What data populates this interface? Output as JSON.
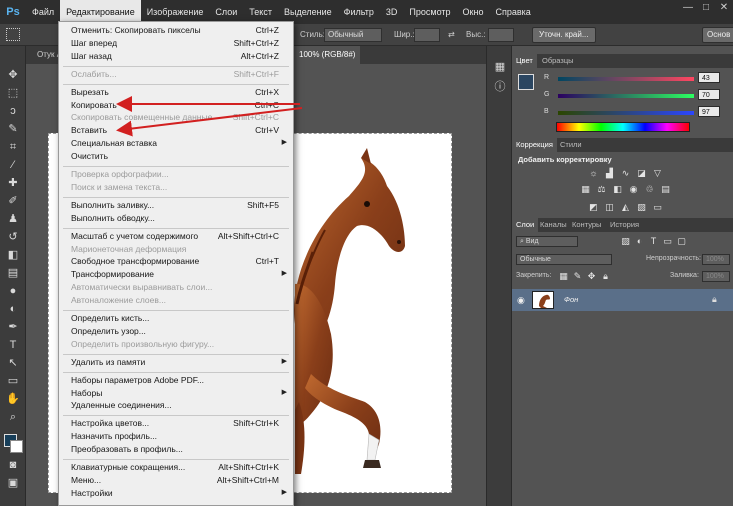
{
  "app": {
    "logo": "Ps"
  },
  "menubar": {
    "items": [
      "Файл",
      "Редактирование",
      "Изображение",
      "Слои",
      "Текст",
      "Выделение",
      "Фильтр",
      "3D",
      "Просмотр",
      "Окно",
      "Справка"
    ],
    "active_index": 1
  },
  "window_controls": {
    "minimize": "—",
    "maximize": "□",
    "close": "✕"
  },
  "options_bar": {
    "style_label": "Стиль:",
    "style_value": "Обычный",
    "width_label": "Шир.:",
    "height_label": "Выс.:",
    "refine_button": "Уточн. край...",
    "workspace_button": "Основ"
  },
  "document_tabs": [
    {
      "label": "Отук А"
    },
    {
      "label": "100% (RGB/8#)"
    }
  ],
  "dropdown": {
    "items": [
      {
        "label": "Отменить: Скопировать пикселы",
        "shortcut": "Ctrl+Z",
        "disabled": false
      },
      {
        "label": "Шаг вперед",
        "shortcut": "Shift+Ctrl+Z",
        "disabled": false
      },
      {
        "label": "Шаг назад",
        "shortcut": "Alt+Ctrl+Z",
        "disabled": false
      },
      {
        "sep": true
      },
      {
        "label": "Ослабить...",
        "shortcut": "Shift+Ctrl+F",
        "disabled": true
      },
      {
        "sep": true
      },
      {
        "label": "Вырезать",
        "shortcut": "Ctrl+X",
        "disabled": false
      },
      {
        "label": "Копировать",
        "shortcut": "Ctrl+C",
        "disabled": false
      },
      {
        "label": "Скопировать совмещенные данные",
        "shortcut": "Shift+Ctrl+C",
        "disabled": true
      },
      {
        "label": "Вставить",
        "shortcut": "Ctrl+V",
        "disabled": false
      },
      {
        "label": "Специальная вставка",
        "shortcut": "",
        "disabled": false,
        "submenu": true
      },
      {
        "label": "Очистить",
        "shortcut": "",
        "disabled": false
      },
      {
        "sep": true
      },
      {
        "label": "Проверка орфографии...",
        "shortcut": "",
        "disabled": true
      },
      {
        "label": "Поиск и замена текста...",
        "shortcut": "",
        "disabled": true
      },
      {
        "sep": true
      },
      {
        "label": "Выполнить заливку...",
        "shortcut": "Shift+F5",
        "disabled": false
      },
      {
        "label": "Выполнить обводку...",
        "shortcut": "",
        "disabled": false
      },
      {
        "sep": true
      },
      {
        "label": "Масштаб с учетом содержимого",
        "shortcut": "Alt+Shift+Ctrl+C",
        "disabled": false
      },
      {
        "label": "Марионеточная деформация",
        "shortcut": "",
        "disabled": true
      },
      {
        "label": "Свободное трансформирование",
        "shortcut": "Ctrl+T",
        "disabled": false
      },
      {
        "label": "Трансформирование",
        "shortcut": "",
        "disabled": false,
        "submenu": true
      },
      {
        "label": "Автоматически выравнивать слои...",
        "shortcut": "",
        "disabled": true
      },
      {
        "label": "Автоналожение слоев...",
        "shortcut": "",
        "disabled": true
      },
      {
        "sep": true
      },
      {
        "label": "Определить кисть...",
        "shortcut": "",
        "disabled": false
      },
      {
        "label": "Определить узор...",
        "shortcut": "",
        "disabled": false
      },
      {
        "label": "Определить произвольную фигуру...",
        "shortcut": "",
        "disabled": true
      },
      {
        "sep": true
      },
      {
        "label": "Удалить из памяти",
        "shortcut": "",
        "disabled": false,
        "submenu": true
      },
      {
        "sep": true
      },
      {
        "label": "Наборы параметров Adobe PDF...",
        "shortcut": "",
        "disabled": false
      },
      {
        "label": "Наборы",
        "shortcut": "",
        "disabled": false,
        "submenu": true
      },
      {
        "label": "Удаленные соединения...",
        "shortcut": "",
        "disabled": false
      },
      {
        "sep": true
      },
      {
        "label": "Настройка цветов...",
        "shortcut": "Shift+Ctrl+K",
        "disabled": false
      },
      {
        "label": "Назначить профиль...",
        "shortcut": "",
        "disabled": false
      },
      {
        "label": "Преобразовать в профиль...",
        "shortcut": "",
        "disabled": false
      },
      {
        "sep": true
      },
      {
        "label": "Клавиатурные сокращения...",
        "shortcut": "Alt+Shift+Ctrl+K",
        "disabled": false
      },
      {
        "label": "Меню...",
        "shortcut": "Alt+Shift+Ctrl+M",
        "disabled": false
      },
      {
        "label": "Настройки",
        "shortcut": "",
        "disabled": false,
        "submenu": true
      }
    ]
  },
  "color_panel": {
    "tabs": [
      "Цвет",
      "Образцы"
    ],
    "r_label": "R",
    "r_value": "43",
    "g_label": "G",
    "g_value": "70",
    "b_label": "B",
    "b_value": "97",
    "foreground_color": "#2b4661"
  },
  "adjustments_panel": {
    "tabs": [
      "Коррекция",
      "Стили"
    ],
    "title": "Добавить корректировку"
  },
  "layers_panel": {
    "tabs": [
      "Слои",
      "Каналы",
      "Контуры",
      "История"
    ],
    "kind_filter": "Вид",
    "blend_mode": "Обычные",
    "opacity_label": "Непрозрачность:",
    "opacity_value": "100%",
    "lock_label": "Закрепить:",
    "fill_label": "Заливка:",
    "fill_value": "100%",
    "layer_name": "Фон"
  },
  "colors": {
    "annotation_arrow": "#d22020",
    "selected_layer": "#5a6f89",
    "menubar_bg": "#2e2e2e"
  }
}
